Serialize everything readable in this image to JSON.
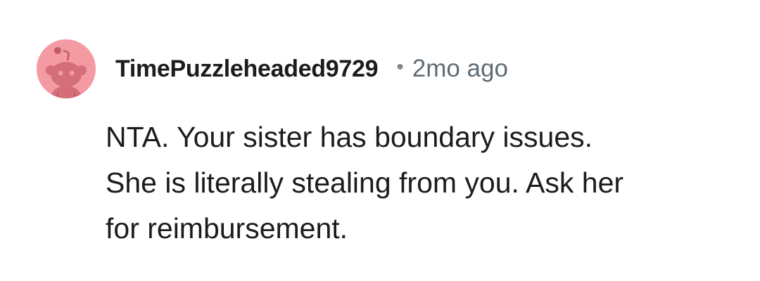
{
  "comment": {
    "author": {
      "username": "TimePuzzleheaded9729",
      "avatar_icon": "snoo-avatar-icon",
      "avatar_color": "#f49aa3"
    },
    "separator": "•",
    "timestamp": "2mo ago",
    "body_lines": [
      "NTA. Your sister has boundary issues.",
      "She is literally stealing from you. Ask her",
      "for reimbursement."
    ]
  },
  "colors": {
    "username": "#1c1c1c",
    "meta": "#5e6c76",
    "body": "#1c1c1c",
    "background": "#ffffff"
  }
}
